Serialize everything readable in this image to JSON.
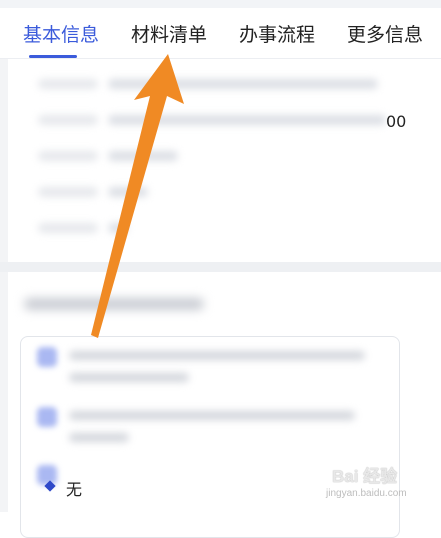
{
  "tabs": [
    {
      "label": "基本信息",
      "active": true
    },
    {
      "label": "材料清单",
      "active": false
    },
    {
      "label": "办事流程",
      "active": false
    },
    {
      "label": "更多信息",
      "active": false
    }
  ],
  "info": {
    "trailing_value": "00"
  },
  "materials": {
    "none_label": "无"
  },
  "watermark": {
    "brand": "Bai 经验",
    "url": "jingyan.baidu.com"
  },
  "colors": {
    "accent": "#3b5bdb",
    "arrow": "#f08a24",
    "text": "#222222"
  }
}
